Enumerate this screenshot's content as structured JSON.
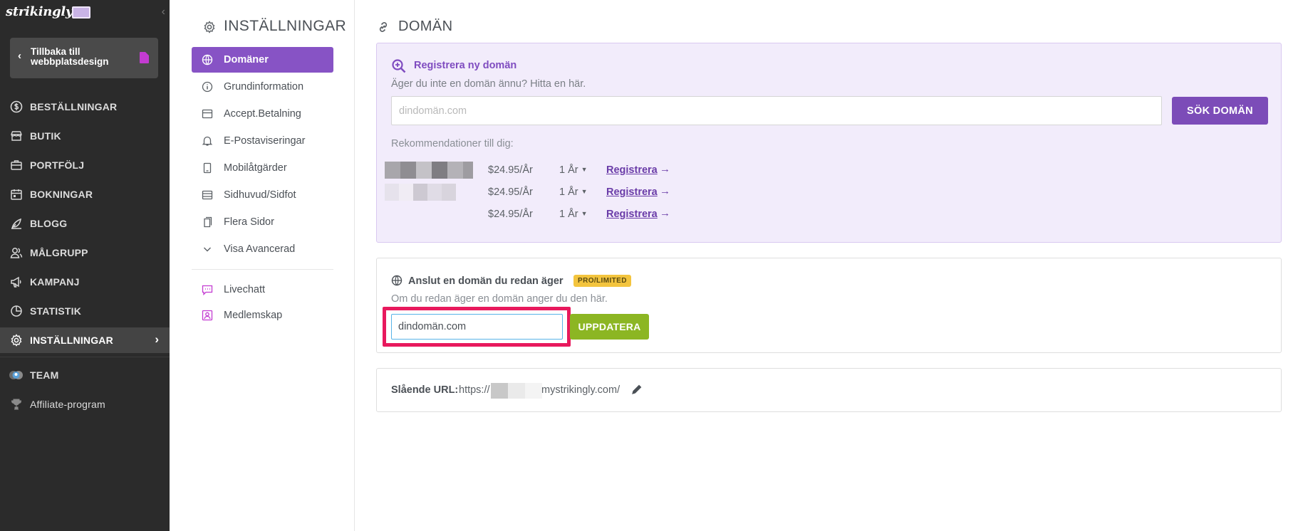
{
  "sidebar": {
    "logo": "strikingly",
    "back_label": "Tillbaka till webbplatsdesign",
    "items": [
      {
        "label": "BESTÄLLNINGAR",
        "icon": "dollar-circle-icon"
      },
      {
        "label": "BUTIK",
        "icon": "store-icon"
      },
      {
        "label": "PORTFÖLJ",
        "icon": "briefcase-icon"
      },
      {
        "label": "BOKNINGAR",
        "icon": "calendar-icon"
      },
      {
        "label": "BLOGG",
        "icon": "quill-icon"
      },
      {
        "label": "MÅLGRUPP",
        "icon": "audience-icon"
      },
      {
        "label": "KAMPANJ",
        "icon": "megaphone-icon"
      },
      {
        "label": "STATISTIK",
        "icon": "pie-chart-icon"
      },
      {
        "label": "INSTÄLLNINGAR",
        "icon": "gear-icon",
        "active": true
      }
    ],
    "team_label": "TEAM",
    "affiliate_label": "Affiliate-program"
  },
  "settings": {
    "title": "INSTÄLLNINGAR",
    "items": [
      {
        "label": "Domäner",
        "icon": "globe-icon",
        "active": true
      },
      {
        "label": "Grundinformation",
        "icon": "info-icon"
      },
      {
        "label": "Accept.Betalning",
        "icon": "card-icon"
      },
      {
        "label": "E-Postaviseringar",
        "icon": "bell-icon"
      },
      {
        "label": "Mobilåtgärder",
        "icon": "mobile-icon"
      },
      {
        "label": "Sidhuvud/Sidfot",
        "icon": "header-footer-icon"
      },
      {
        "label": "Flera Sidor",
        "icon": "pages-icon"
      },
      {
        "label": "Visa Avancerad",
        "icon": "chevron-down-icon"
      }
    ],
    "extra_items": [
      {
        "label": "Livechatt",
        "icon": "chat-icon"
      },
      {
        "label": "Medlemskap",
        "icon": "membership-icon"
      }
    ]
  },
  "domain": {
    "title": "DOMÄN",
    "register": {
      "title": "Registrera ny domän",
      "subtitle": "Äger du inte en domän ännu? Hitta en här.",
      "placeholder": "dindomän.com",
      "search_button": "SÖK DOMÄN",
      "recommend_label": "Rekommendationer till dig:",
      "recommendations": [
        {
          "price": "$24.95/År",
          "term": "1 År",
          "action": "Registrera"
        },
        {
          "price": "$24.95/År",
          "term": "1 År",
          "action": "Registrera"
        },
        {
          "price": "$24.95/År",
          "term": "1 År",
          "action": "Registrera"
        }
      ]
    },
    "connect": {
      "title": "Anslut en domän du redan äger",
      "badge": "PRO/LIMITED",
      "subtitle": "Om du redan äger en domän anger du den här.",
      "value": "dindomän.com",
      "update_button": "UPPDATERA"
    },
    "url": {
      "label": "Slående URL:",
      "prefix": "https://",
      "suffix": "mystrikingly.com/"
    }
  },
  "colors": {
    "sidebar_bg": "#2b2b2b",
    "accent_purple": "#8753c5",
    "button_green": "#8cb623",
    "badge_yellow": "#f3c43e",
    "highlight_pink": "#e8195d"
  }
}
